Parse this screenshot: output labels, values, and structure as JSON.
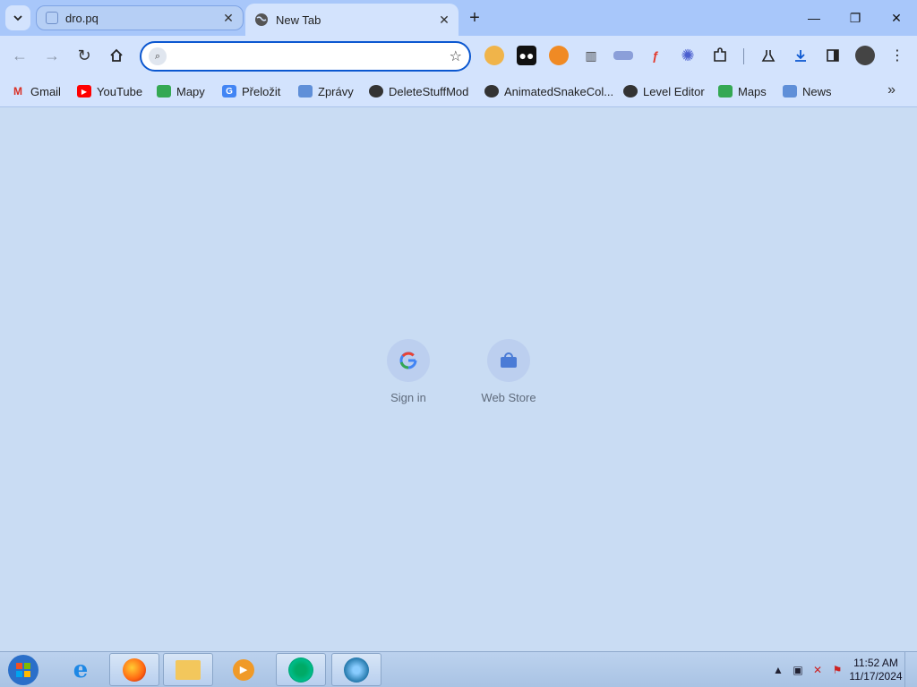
{
  "tabs": [
    {
      "title": "dro.pq",
      "active": false
    },
    {
      "title": "New Tab",
      "active": true
    }
  ],
  "omnibox": {
    "value": "",
    "placeholder": ""
  },
  "bookmarks": [
    {
      "label": "Gmail",
      "icon": "gmail-icon"
    },
    {
      "label": "YouTube",
      "icon": "youtube-icon"
    },
    {
      "label": "Mapy",
      "icon": "maps-icon"
    },
    {
      "label": "Přeložit",
      "icon": "translate-icon"
    },
    {
      "label": "Zprávy",
      "icon": "news-icon"
    },
    {
      "label": "DeleteStuffMod",
      "icon": "globe-icon"
    },
    {
      "label": "AnimatedSnakeCol...",
      "icon": "globe-icon"
    },
    {
      "label": "Level Editor",
      "icon": "globe-icon"
    },
    {
      "label": "Maps",
      "icon": "maps-icon"
    },
    {
      "label": "News",
      "icon": "news-icon"
    }
  ],
  "shortcuts": [
    {
      "label": "Sign in",
      "icon": "google-icon"
    },
    {
      "label": "Web Store",
      "icon": "web-store-icon"
    }
  ],
  "clock": {
    "time": "11:52 AM",
    "date": "11/17/2024"
  },
  "colors": {
    "tabstrip": "#a8c7fa",
    "toolbar": "#d3e3fd",
    "content": "#c9dcf3",
    "accent": "#0b57d0"
  }
}
